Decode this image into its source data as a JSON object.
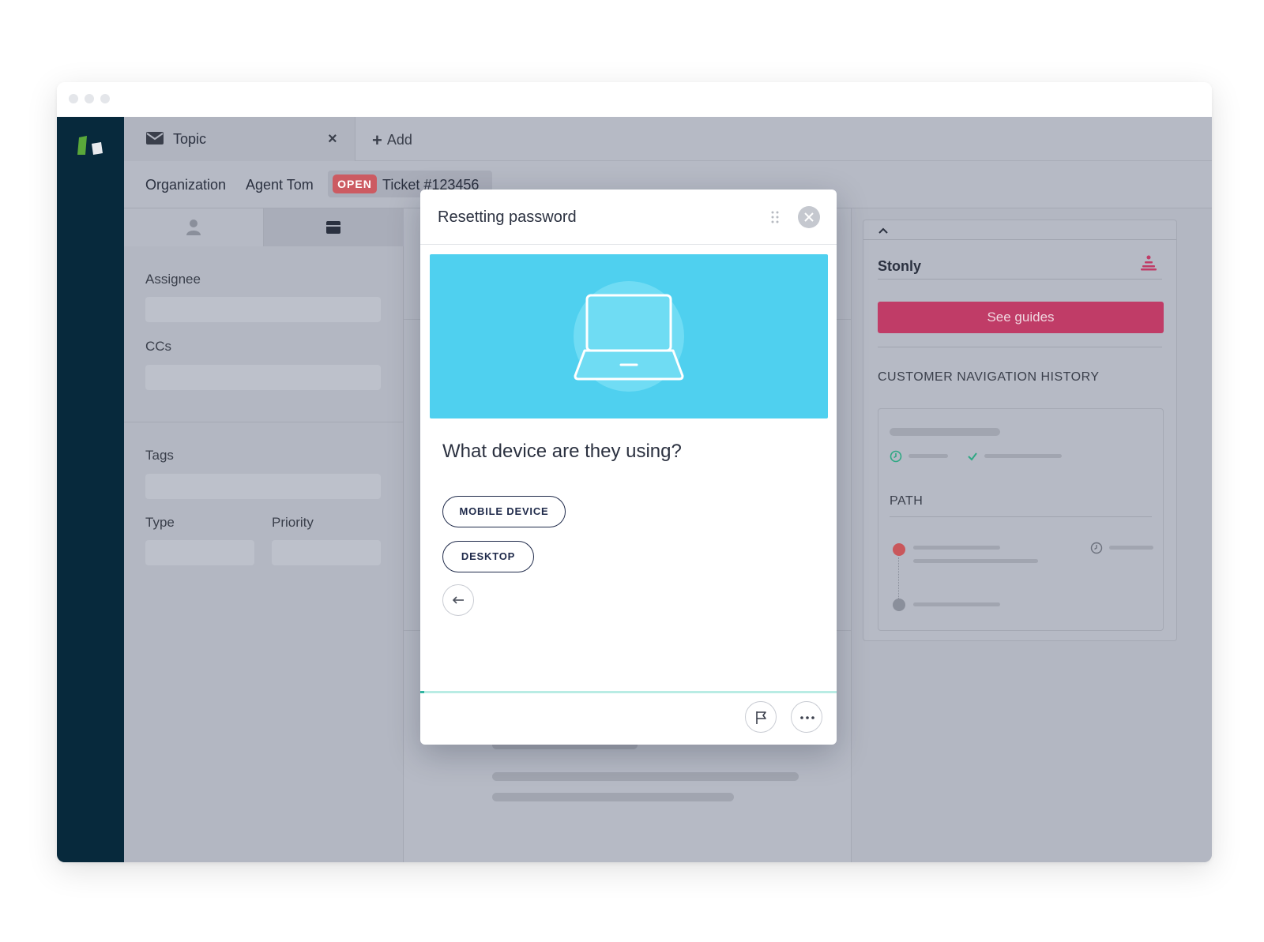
{
  "window": {
    "controls": [
      "close",
      "minimize",
      "maximize"
    ]
  },
  "app": {
    "logo_icon": "app-logo-icon"
  },
  "tabs": [
    {
      "label": "Topic",
      "icon": "mail-icon",
      "close_label": "×"
    }
  ],
  "add_tab": {
    "label": "Add"
  },
  "breadcrumb": {
    "organization": "Organization",
    "agent": "Agent Tom",
    "status": "OPEN",
    "ticket": "Ticket #123456"
  },
  "left_panel": {
    "tabs": [
      {
        "icon": "user-icon"
      },
      {
        "icon": "card-icon"
      }
    ],
    "fields": {
      "assignee": "Assignee",
      "ccs": "CCs",
      "tags": "Tags",
      "type": "Type",
      "priority": "Priority"
    }
  },
  "modal": {
    "title": "Resetting password",
    "question": "What device are they using?",
    "options": [
      "MOBILE DEVICE",
      "DESKTOP"
    ],
    "progress": 0.01
  },
  "right_panel": {
    "title": "Stonly",
    "button_label": "See guides",
    "section_title": "CUSTOMER NAVIGATION HISTORY",
    "path_label": "PATH"
  },
  "colors": {
    "sidebar": "#07293c",
    "accent_pink": "#c03c67",
    "hero_blue": "#4fd0ef",
    "open_badge": "#cc5b62",
    "progress_teal": "#2fb5a0"
  }
}
